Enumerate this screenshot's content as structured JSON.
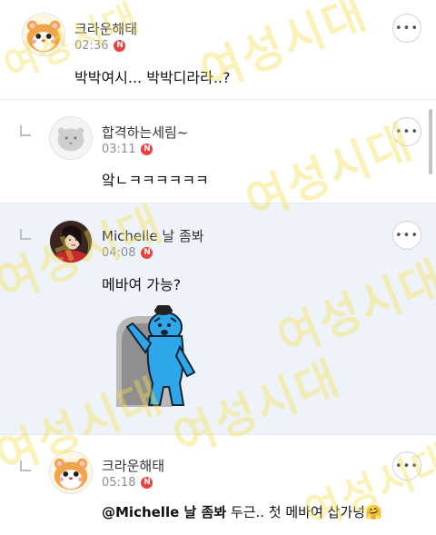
{
  "comments": [
    {
      "nickname": "크라운해태",
      "time": "02:36",
      "badge": "N",
      "text": "박박여시... 박박디라라..?"
    },
    {
      "nickname": "합격하는세림~",
      "time": "03:11",
      "badge": "N",
      "text": "앜ㄴㅋㅋㅋㅋㅋㅋ"
    },
    {
      "nickname": "Michelle 날 좀봐",
      "time": "04:08",
      "badge": "N",
      "text": "메바여 가능?"
    },
    {
      "nickname": "크라운해태",
      "time": "05:18",
      "badge": "N",
      "mention": "@Michelle 날 좀봐",
      "text": " 두근.. 첫 메바여 삽가넝",
      "emoji": "🤗"
    }
  ],
  "more_label": "•••",
  "watermark": "여성시대",
  "colors": {
    "reply_highlight_bg": "#eef3fa",
    "badge": "#ef3f3f",
    "watermark": "#f6de50",
    "sticker_character": "#2ea7ea"
  }
}
